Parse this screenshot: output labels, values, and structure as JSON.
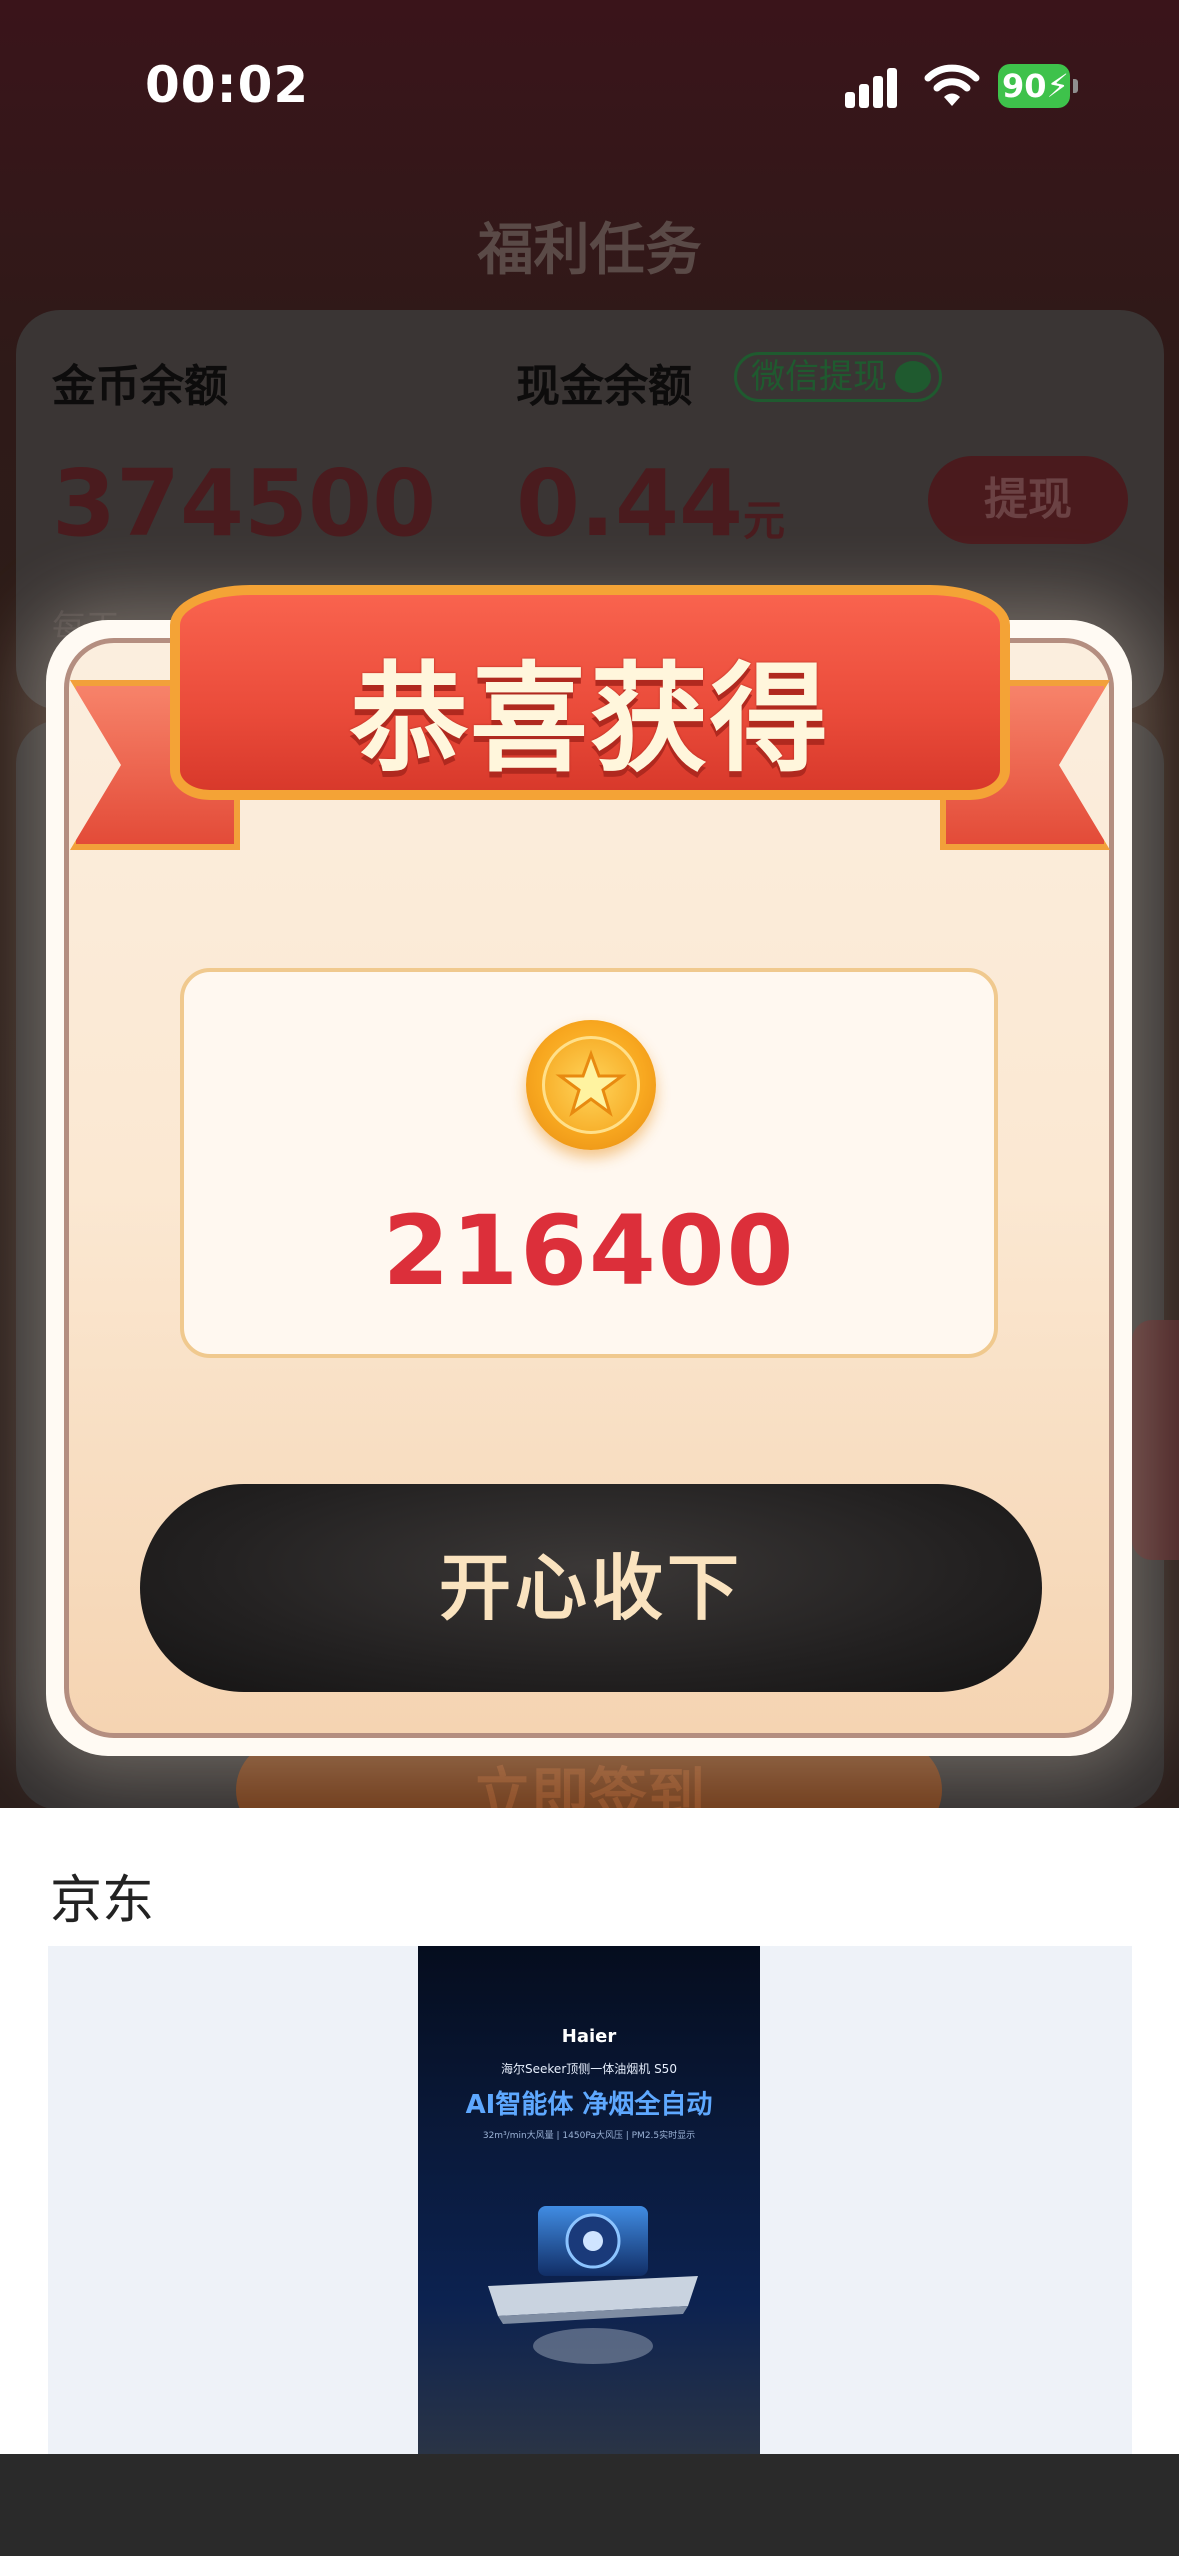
{
  "status_bar": {
    "time": "00:02",
    "battery": "90"
  },
  "background_page": {
    "title": "福利任务",
    "coin_balance_label": "金币余额",
    "cash_balance_label": "现金余额",
    "wechat_withdraw_badge": "微信提现",
    "coin_balance_value": "374500",
    "cash_balance_value": "0.44",
    "cash_unit": "元",
    "withdraw_button": "提现",
    "note_partial": "每天",
    "checkin_button": "立即签到"
  },
  "modal": {
    "title": "恭喜获得",
    "reward_amount": "216400",
    "accept_button": "开心收下",
    "coin_icon": "gold-star-coin-icon"
  },
  "ad": {
    "source": "京东",
    "poster": {
      "brand": "Haier",
      "line1": "海尔Seeker顶侧一体油烟机 S50",
      "headline": "AI智能体 净烟全自动",
      "specs": "32m³/min大风量 | 1450Pa大风压 | PM2.5实时显示"
    }
  },
  "colors": {
    "reward_red": "#dc2f3a",
    "ribbon_red": "#ea4b3a",
    "ribbon_gold": "#f4a336",
    "button_dark": "#232121",
    "button_text": "#fae3bf"
  }
}
